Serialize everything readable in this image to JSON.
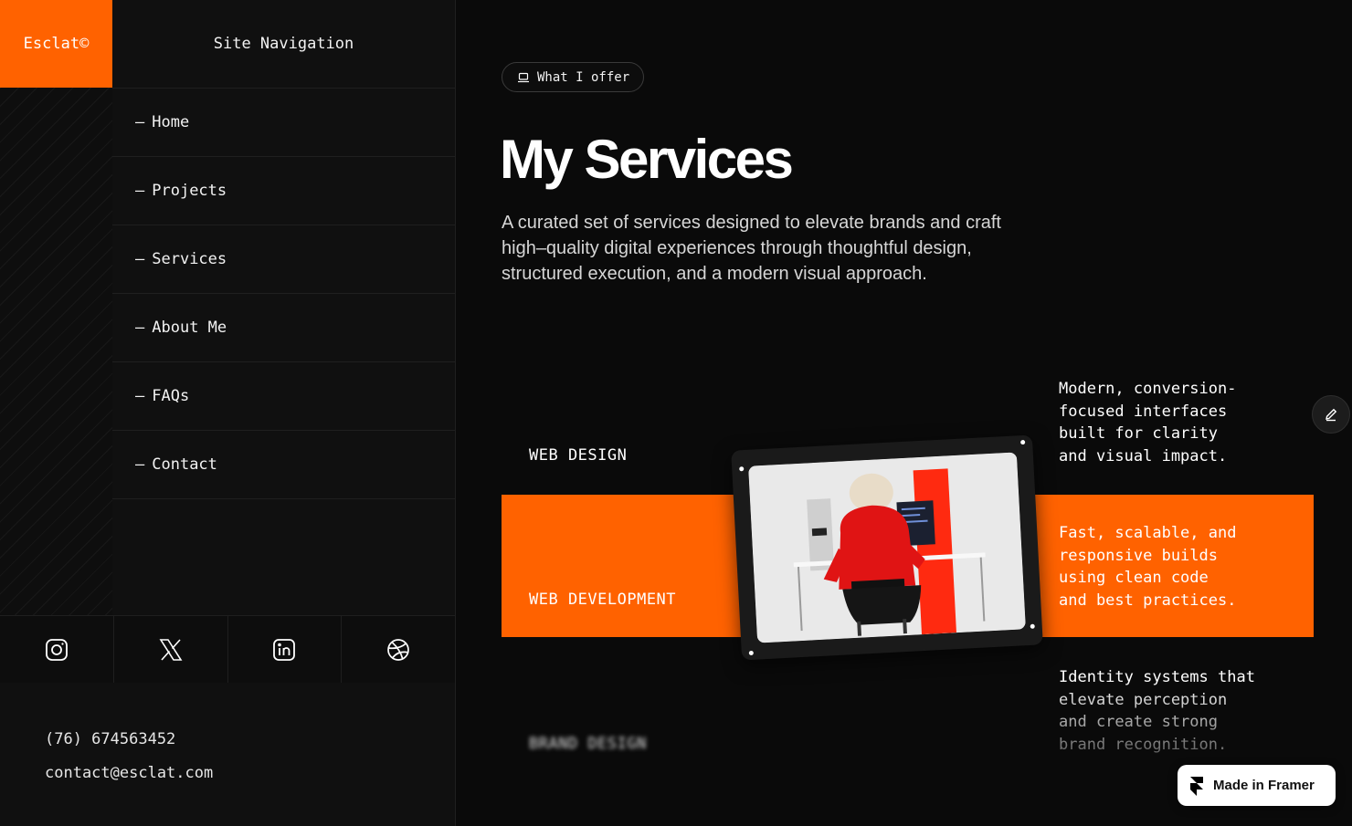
{
  "brand": {
    "logo": "Esclat©",
    "accent_color": "#ff6200"
  },
  "nav": {
    "header": "Site Navigation",
    "items": [
      {
        "label": "Home"
      },
      {
        "label": "Projects"
      },
      {
        "label": "Services"
      },
      {
        "label": "About Me"
      },
      {
        "label": "FAQs"
      },
      {
        "label": "Contact"
      }
    ],
    "dash": "—"
  },
  "social": [
    "instagram-icon",
    "x-icon",
    "linkedin-icon",
    "dribbble-icon"
  ],
  "contact": {
    "phone": "(76) 674563452",
    "email": "contact@esclat.com"
  },
  "main": {
    "pill_label": "What I offer",
    "heading": "My Services",
    "lead": "A curated set of services designed to elevate brands and craft high–quality digital experiences through thoughtful design, structured execution, and a modern visual approach."
  },
  "services": [
    {
      "title": "WEB DESIGN",
      "description": "Modern, conversion-\nfocused interfaces\nbuilt for clarity\nand visual impact."
    },
    {
      "title": "WEB DEVELOPMENT",
      "description": "Fast, scalable, and\nresponsive builds\nusing clean code\nand best practices."
    },
    {
      "title": "BRAND DESIGN",
      "description": "Identity systems that\nelevate perception\nand create strong\nbrand recognition."
    }
  ],
  "badge": {
    "label": "Made in Framer"
  }
}
